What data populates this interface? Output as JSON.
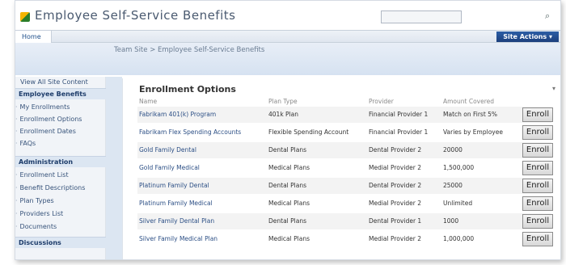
{
  "site": {
    "title": "Employee Self-Service Benefits",
    "site_actions": "Site Actions ▾",
    "home_tab": "Home"
  },
  "breadcrumb": "Team Site > Employee Self-Service Benefits",
  "sidebar": {
    "view_all": "View All Site Content",
    "sections": [
      {
        "heading": "Employee Benefits",
        "items": [
          "My Enrollments",
          "Enrollment Options",
          "Enrollment Dates",
          "FAQs"
        ]
      },
      {
        "heading": "Administration",
        "items": [
          "Enrollment List",
          "Benefit Descriptions",
          "Plan Types",
          "Providers List",
          "Documents"
        ]
      },
      {
        "heading": "Discussions",
        "items": []
      }
    ]
  },
  "enrollment": {
    "title": "Enrollment Options",
    "columns": [
      "Name",
      "Plan Type",
      "Provider",
      "Amount Covered"
    ],
    "button_label": "Enroll",
    "rows": [
      {
        "name": "Fabrikam 401(k) Program",
        "plan_type": "401k Plan",
        "provider": "Financial Provider 1",
        "amount": "Match on First 5%"
      },
      {
        "name": "Fabrikam Flex Spending Accounts",
        "plan_type": "Flexible Spending Account",
        "provider": "Financial Provider 1",
        "amount": "Varies by Employee"
      },
      {
        "name": "Gold Family Dental",
        "plan_type": "Dental Plans",
        "provider": "Dental Provider 2",
        "amount": "20000"
      },
      {
        "name": "Gold Family Medical",
        "plan_type": "Medical Plans",
        "provider": "Medial Provider 2",
        "amount": "1,500,000"
      },
      {
        "name": "Platinum Family Dental",
        "plan_type": "Dental Plans",
        "provider": "Dental Provider 2",
        "amount": "25000"
      },
      {
        "name": "Platinum Family Medical",
        "plan_type": "Medical Plans",
        "provider": "Medial Provider 2",
        "amount": "Unlimited"
      },
      {
        "name": "Silver Family Dental Plan",
        "plan_type": "Dental Plans",
        "provider": "Dental Provider 1",
        "amount": "1000"
      },
      {
        "name": "Silver Family Medical Plan",
        "plan_type": "Medical Plans",
        "provider": "Medial Provider 2",
        "amount": "1,000,000"
      }
    ]
  }
}
